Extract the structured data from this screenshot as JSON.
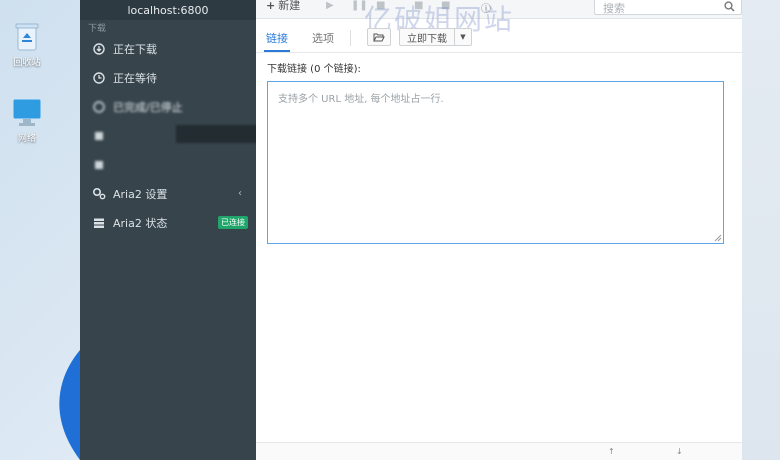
{
  "desktop": {
    "icons": [
      {
        "label": "回收站",
        "icon": "recycle-bin-icon"
      },
      {
        "label": "网络",
        "icon": "network-icon"
      }
    ]
  },
  "sidebar": {
    "host": "localhost:6800",
    "section_header": "下载",
    "items": [
      {
        "label": "正在下载",
        "icon": "download-circle-icon"
      },
      {
        "label": "正在等待",
        "icon": "clock-icon"
      },
      {
        "label": "已完成/已停止",
        "icon": "stop-icon"
      },
      {
        "label": "",
        "icon": "blurred-icon"
      },
      {
        "label": "",
        "icon": "blurred-icon"
      },
      {
        "label": "Aria2 设置",
        "icon": "gears-icon"
      },
      {
        "label": "Aria2 状态",
        "icon": "server-icon",
        "badge": "已连接"
      }
    ]
  },
  "toolbar": {
    "new_label": "新建",
    "search_placeholder": "搜索"
  },
  "tabs": {
    "link": "链接",
    "options": "选项"
  },
  "buttons": {
    "download_now": "立即下载"
  },
  "form": {
    "label": "下载链接 (0 个链接):",
    "placeholder": "支持多个 URL 地址, 每个地址占一行."
  },
  "watermark": "亿破姐网站",
  "colors": {
    "sidebar_bg": "#37444c",
    "accent": "#2a7bd8",
    "badge": "#1fa66a"
  }
}
